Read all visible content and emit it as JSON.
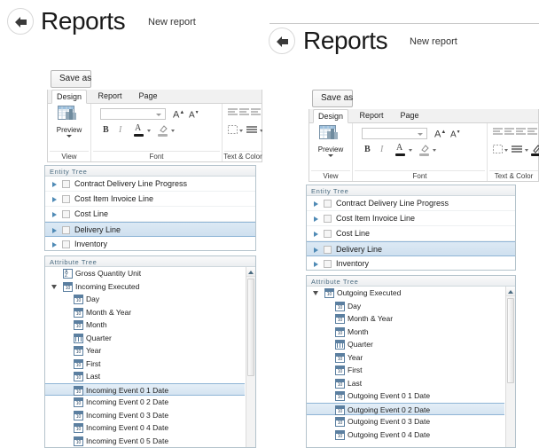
{
  "panels": [
    {
      "id": "left",
      "header": {
        "back_icon": "back-arrow-icon",
        "title": "Reports",
        "subtitle": "New report"
      },
      "save_as_label": "Save as",
      "ribbon": {
        "tabs": [
          {
            "label": "Design",
            "active": true
          },
          {
            "label": "Report",
            "active": false
          },
          {
            "label": "Page",
            "active": false
          }
        ],
        "groups": [
          {
            "label": "View"
          },
          {
            "label": "Font"
          },
          {
            "label": "Text & Color"
          }
        ],
        "preview_label": "Preview",
        "font_name_value": "",
        "font_grow_label": "A",
        "font_shrink_label": "A",
        "bold_label": "B",
        "italic_label": "I",
        "font_color_label": "A",
        "highlight_label": "ab",
        "font_color_swatch": "#1b1b1b",
        "highlight_swatch": "#b0b0b0",
        "text_color_swatch": "#1b1b1b"
      },
      "entity_tree": {
        "header": "Entity Tree",
        "rows": [
          {
            "label": "Contract Delivery Line Progress",
            "selected": false
          },
          {
            "label": "Cost Item Invoice Line",
            "selected": false
          },
          {
            "label": "Cost Line",
            "selected": false
          },
          {
            "label": "Delivery Line",
            "selected": true
          },
          {
            "label": "Inventory",
            "selected": false
          }
        ]
      },
      "attribute_tree": {
        "header": "Attribute Tree",
        "rows": [
          {
            "label": "Gross Quantity Unit",
            "icon": "az-sort-icon",
            "indent": 1,
            "expander": "none",
            "selected": false
          },
          {
            "label": "Incoming Executed",
            "icon": "calendar-icon",
            "indent": 1,
            "expander": "expanded",
            "selected": false
          },
          {
            "label": "Day",
            "icon": "calendar-icon",
            "indent": 2,
            "expander": "none",
            "selected": false
          },
          {
            "label": "Month & Year",
            "icon": "calendar-icon",
            "indent": 2,
            "expander": "none",
            "selected": false
          },
          {
            "label": "Month",
            "icon": "calendar-icon",
            "indent": 2,
            "expander": "none",
            "selected": false
          },
          {
            "label": "Quarter",
            "icon": "quarter-icon",
            "indent": 2,
            "expander": "none",
            "selected": false
          },
          {
            "label": "Year",
            "icon": "calendar-icon",
            "indent": 2,
            "expander": "none",
            "selected": false
          },
          {
            "label": "First",
            "icon": "calendar-icon",
            "indent": 2,
            "expander": "none",
            "selected": false
          },
          {
            "label": "Last",
            "icon": "calendar-icon",
            "indent": 2,
            "expander": "none",
            "selected": false
          },
          {
            "label": "Incoming Event 0 1 Date",
            "icon": "calendar-icon",
            "indent": 2,
            "expander": "none",
            "selected": true
          },
          {
            "label": "Incoming Event 0 2 Date",
            "icon": "calendar-icon",
            "indent": 2,
            "expander": "none",
            "selected": false
          },
          {
            "label": "Incoming Event 0 3 Date",
            "icon": "calendar-icon",
            "indent": 2,
            "expander": "none",
            "selected": false
          },
          {
            "label": "Incoming Event 0 4 Date",
            "icon": "calendar-icon",
            "indent": 2,
            "expander": "none",
            "selected": false
          },
          {
            "label": "Incoming Event 0 5 Date",
            "icon": "calendar-icon",
            "indent": 2,
            "expander": "none",
            "selected": false
          }
        ]
      }
    },
    {
      "id": "right",
      "header": {
        "back_icon": "back-arrow-icon",
        "title": "Reports",
        "subtitle": "New report"
      },
      "save_as_label": "Save as",
      "ribbon": {
        "tabs": [
          {
            "label": "Design",
            "active": true
          },
          {
            "label": "Report",
            "active": false
          },
          {
            "label": "Page",
            "active": false
          }
        ],
        "groups": [
          {
            "label": "View"
          },
          {
            "label": "Font"
          },
          {
            "label": "Text & Color"
          }
        ],
        "preview_label": "Preview",
        "font_name_value": "",
        "font_grow_label": "A",
        "font_shrink_label": "A",
        "bold_label": "B",
        "italic_label": "I",
        "font_color_label": "A",
        "highlight_label": "ab",
        "font_color_swatch": "#1b1b1b",
        "highlight_swatch": "#b0b0b0",
        "text_color_swatch": "#1b1b1b"
      },
      "entity_tree": {
        "header": "Entity Tree",
        "rows": [
          {
            "label": "Contract Delivery Line Progress",
            "selected": false
          },
          {
            "label": "Cost Item Invoice Line",
            "selected": false
          },
          {
            "label": "Cost Line",
            "selected": false
          },
          {
            "label": "Delivery Line",
            "selected": true
          },
          {
            "label": "Inventory",
            "selected": false
          }
        ]
      },
      "attribute_tree": {
        "header": "Attribute Tree",
        "rows": [
          {
            "label": "Outgoing Executed",
            "icon": "calendar-icon",
            "indent": 1,
            "expander": "expanded",
            "selected": false
          },
          {
            "label": "Day",
            "icon": "calendar-icon",
            "indent": 2,
            "expander": "none",
            "selected": false
          },
          {
            "label": "Month & Year",
            "icon": "calendar-icon",
            "indent": 2,
            "expander": "none",
            "selected": false
          },
          {
            "label": "Month",
            "icon": "calendar-icon",
            "indent": 2,
            "expander": "none",
            "selected": false
          },
          {
            "label": "Quarter",
            "icon": "quarter-icon",
            "indent": 2,
            "expander": "none",
            "selected": false
          },
          {
            "label": "Year",
            "icon": "calendar-icon",
            "indent": 2,
            "expander": "none",
            "selected": false
          },
          {
            "label": "First",
            "icon": "calendar-icon",
            "indent": 2,
            "expander": "none",
            "selected": false
          },
          {
            "label": "Last",
            "icon": "calendar-icon",
            "indent": 2,
            "expander": "none",
            "selected": false
          },
          {
            "label": "Outgoing Event 0 1 Date",
            "icon": "calendar-icon",
            "indent": 2,
            "expander": "none",
            "selected": false
          },
          {
            "label": "Outgoing Event 0 2 Date",
            "icon": "calendar-icon",
            "indent": 2,
            "expander": "none",
            "selected": true
          },
          {
            "label": "Outgoing Event 0 3 Date",
            "icon": "calendar-icon",
            "indent": 2,
            "expander": "none",
            "selected": false
          },
          {
            "label": "Outgoing Event 0 4 Date",
            "icon": "calendar-icon",
            "indent": 2,
            "expander": "none",
            "selected": false
          }
        ]
      }
    }
  ],
  "icon_glyphs": {
    "calendar_number": "10",
    "az_top": "A",
    "az_bottom": "Z"
  }
}
